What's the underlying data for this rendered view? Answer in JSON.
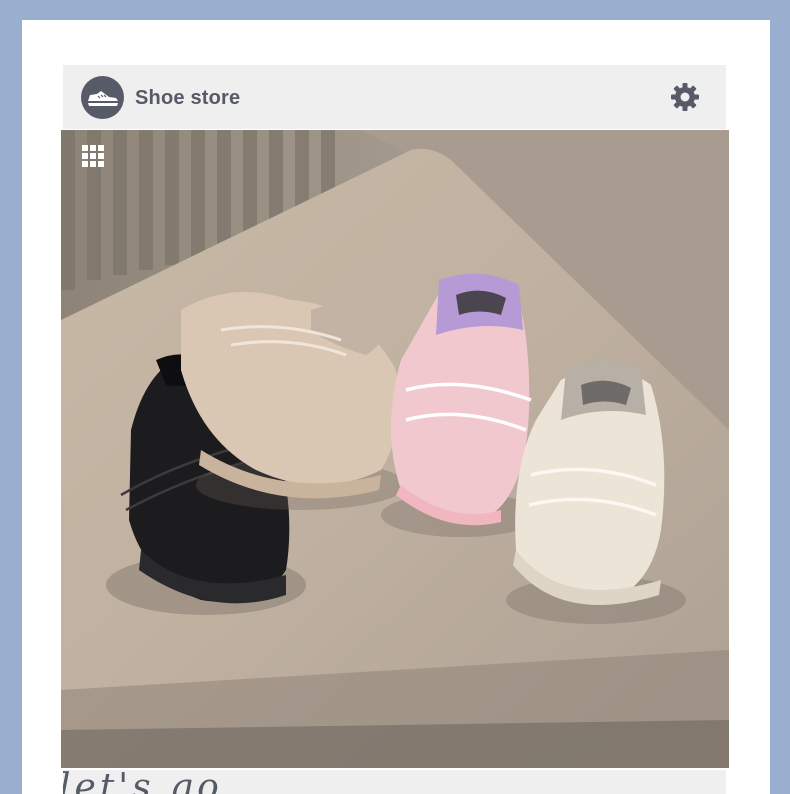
{
  "header": {
    "title": "Shoe store",
    "logo_icon": "sneaker-icon",
    "settings_icon": "gear-icon"
  },
  "photo": {
    "menu_icon": "grid-icon",
    "subject": "sneakers-photo"
  },
  "bottom": {
    "script_text": "let's go"
  },
  "colors": {
    "frame_border": "#9aaed0",
    "header_bg": "#efefef",
    "brand_dark": "#575b67",
    "background": "#ffffff"
  }
}
